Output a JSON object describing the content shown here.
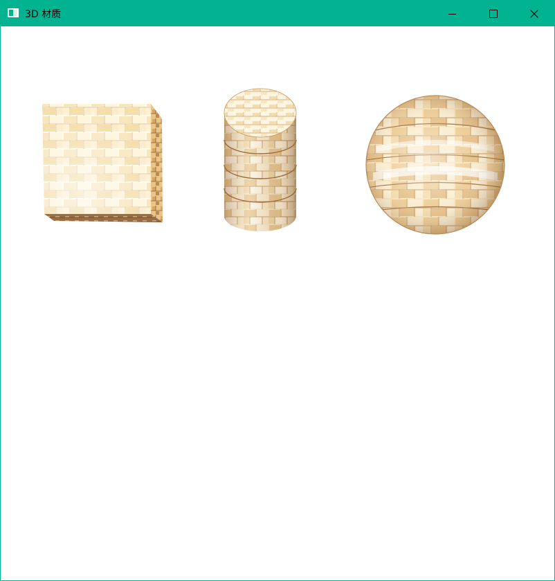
{
  "window": {
    "title": "3D 材质",
    "controls": {
      "minimize": "minimize-icon",
      "maximize": "maximize-icon",
      "close": "close-icon"
    },
    "titlebar_color": "#01b391"
  },
  "scene": {
    "objects": [
      {
        "shape": "cube",
        "material": "stone-brick"
      },
      {
        "shape": "cylinder",
        "material": "stone-brick"
      },
      {
        "shape": "sphere",
        "material": "stone-brick"
      }
    ],
    "texture_colors": {
      "highlight": "#fffbef",
      "base": "#f4deaa",
      "mortar": "#c48a4a",
      "shadow": "#8c5a2e"
    }
  }
}
